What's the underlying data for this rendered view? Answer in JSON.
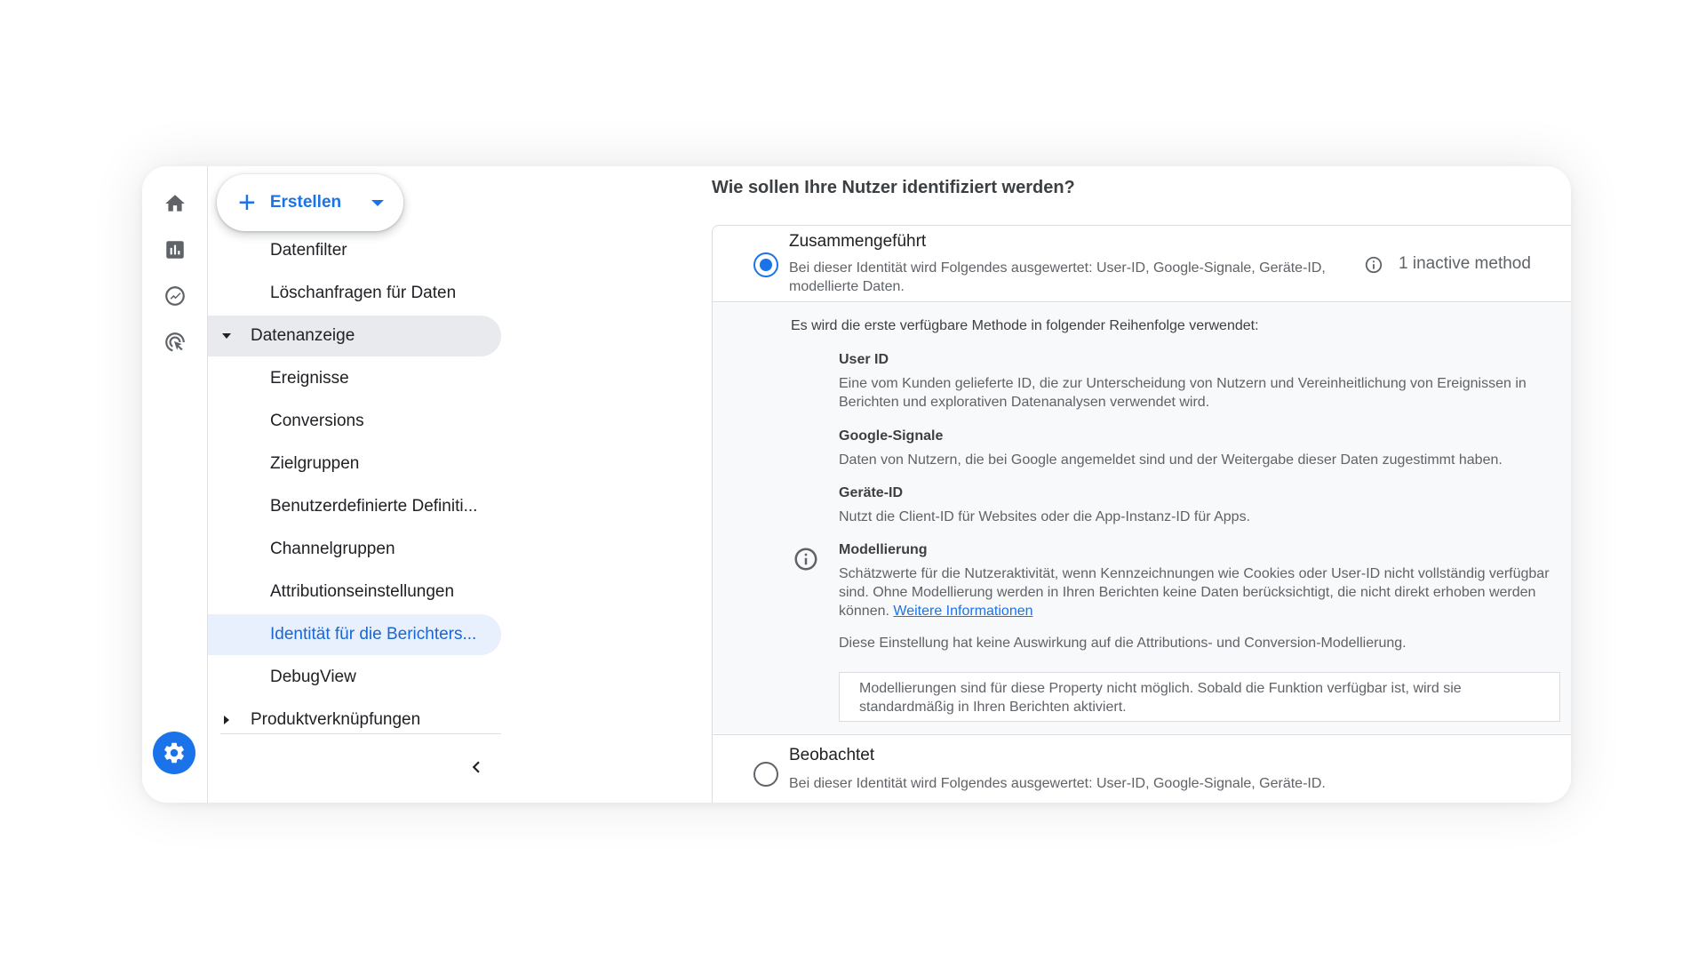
{
  "rail": {
    "items": [
      {
        "name": "home-icon"
      },
      {
        "name": "reports-icon"
      },
      {
        "name": "explore-icon"
      },
      {
        "name": "advertising-icon"
      }
    ],
    "settings_icon": "gear-icon"
  },
  "nav": {
    "create_label": "Erstellen",
    "items": [
      {
        "label": "Datenfilter",
        "level": "sub"
      },
      {
        "label": "Löschanfragen für Daten",
        "level": "sub"
      },
      {
        "label": "Datenanzeige",
        "level": "group",
        "expanded": true
      },
      {
        "label": "Ereignisse",
        "level": "sub"
      },
      {
        "label": "Conversions",
        "level": "sub"
      },
      {
        "label": "Zielgruppen",
        "level": "sub"
      },
      {
        "label": "Benutzerdefinierte Definiti...",
        "level": "sub"
      },
      {
        "label": "Channelgruppen",
        "level": "sub"
      },
      {
        "label": "Attributionseinstellungen",
        "level": "sub"
      },
      {
        "label": "Identität für die Berichters...",
        "level": "sub",
        "selected": true
      },
      {
        "label": "DebugView",
        "level": "sub"
      },
      {
        "label": "Produktverknüpfungen",
        "level": "group",
        "expanded": false
      }
    ]
  },
  "main": {
    "question": "Wie sollen Ihre Nutzer identifiziert werden?",
    "option1": {
      "title": "Zusammengeführt",
      "desc": "Bei dieser Identität wird Folgendes ausgewertet: User-ID, Google-Signale, Geräte-ID, modellierte Daten.",
      "inactive": "1 inactive method",
      "selected": true
    },
    "expanded": {
      "intro": "Es wird die erste verfügbare Methode in folgender Reihenfolge verwendet:",
      "methods": [
        {
          "title": "User ID",
          "text": "Eine vom Kunden gelieferte ID, die zur Unterscheidung von Nutzern und Vereinheitlichung von Ereignissen in Berichten und explorativen Datenanalysen verwendet wird."
        },
        {
          "title": "Google-Signale",
          "text": "Daten von Nutzern, die bei Google angemeldet sind und der Weitergabe dieser Daten zugestimmt haben."
        },
        {
          "title": "Geräte-ID",
          "text": "Nutzt die Client-ID für Websites oder die App-Instanz-ID für Apps."
        },
        {
          "title": "Modellierung",
          "text": "Schätzwerte für die Nutzeraktivität, wenn Kennzeichnungen wie Cookies oder User-ID nicht vollständig verfügbar sind. Ohne Modellierung werden in Ihren Berichten keine Daten berücksichtigt, die nicht direkt erhoben werden können.",
          "link": "Weitere Informationen"
        }
      ],
      "note": "Diese Einstellung hat keine Auswirkung auf die Attributions- und Conversion-Modellierung.",
      "notice": "Modellierungen sind für diese Property nicht möglich. Sobald die Funktion verfügbar ist, wird sie standardmäßig in Ihren Berichten aktiviert."
    },
    "option2": {
      "title": "Beobachtet",
      "desc": "Bei dieser Identität wird Folgendes ausgewertet: User-ID, Google-Signale, Geräte-ID.",
      "selected": false
    }
  },
  "colors": {
    "accent": "#1a73e8",
    "selected_bg": "#e8f0fe",
    "active_group_bg": "#e8eaed"
  }
}
